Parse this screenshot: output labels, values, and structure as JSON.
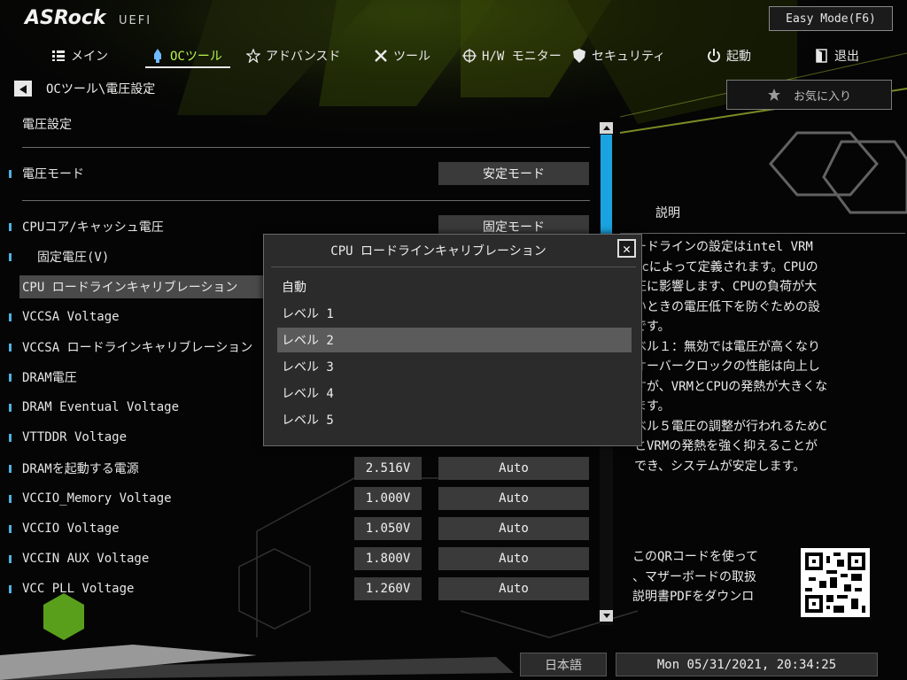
{
  "header": {
    "logo": "ASRock",
    "logo_sub": "UEFI",
    "easy_mode": "Easy Mode(F6)"
  },
  "nav": [
    {
      "label": "メイン",
      "icon": "list-icon"
    },
    {
      "label": "OCツール",
      "icon": "rocket-icon",
      "active": true
    },
    {
      "label": "アドバンスド",
      "icon": "star-icon"
    },
    {
      "label": "ツール",
      "icon": "tools-icon"
    },
    {
      "label": "H/W モニター",
      "icon": "crosshair-icon"
    },
    {
      "label": "セキュリティ",
      "icon": "shield-icon"
    },
    {
      "label": "起動",
      "icon": "power-icon"
    },
    {
      "label": "退出",
      "icon": "exit-door-icon"
    }
  ],
  "breadcrumb": "OCツール\\電圧設定",
  "favorite": "お気に入り",
  "section_title": "電圧設定",
  "rows": [
    {
      "label": "電圧モード",
      "mode": "安定モード"
    },
    {
      "label": "CPUコア/キャッシュ電圧",
      "mode": "固定モード"
    },
    {
      "label": "固定電圧(V)"
    },
    {
      "label": "CPU ロードラインキャリブレーション"
    },
    {
      "label": "VCCSA Voltage"
    },
    {
      "label": "VCCSA ロードラインキャリブレーション"
    },
    {
      "label": "DRAM電圧"
    },
    {
      "label": "DRAM Eventual Voltage"
    },
    {
      "label": "VTTDDR Voltage"
    },
    {
      "label": "DRAMを起動する電源",
      "value": "2.516V",
      "mode": "Auto"
    },
    {
      "label": "VCCIO_Memory Voltage",
      "value": "1.000V",
      "mode": "Auto"
    },
    {
      "label": "VCCIO Voltage",
      "value": "1.050V",
      "mode": "Auto"
    },
    {
      "label": "VCCIN AUX Voltage",
      "value": "1.800V",
      "mode": "Auto"
    },
    {
      "label": "VCC PLL Voltage",
      "value": "1.260V",
      "mode": "Auto"
    }
  ],
  "description": {
    "title": "説明",
    "text": "ードラインの設定はintel VRM\necによって定義されます。CPUの\n圧に影響します、CPUの負荷が大\nいときの電圧低下を防ぐための設\nです。\nベル１：無効では電圧が高くなり\nオーバークロックの性能は向上し\nすが、VRMとCPUの発熱が大きくな\nます。\nベル５電圧の調整が行われるためC\nとVRMの発熱を強く抑えることが\nでき、システムが安定します。",
    "qr_text": "このQRコードを使って\n、マザーボードの取扱\n説明書PDFをダウンロ"
  },
  "popup": {
    "title": "CPU ロードラインキャリブレーション",
    "options": [
      "自動",
      "レベル 1",
      "レベル 2",
      "レベル 3",
      "レベル 4",
      "レベル 5"
    ],
    "selected": "レベル 2"
  },
  "status": {
    "language": "日本語",
    "datetime": "Mon 05/31/2021, 20:34:25"
  },
  "colors": {
    "accent_green": "#b9f24c",
    "scroll_blue": "#1aa3e0",
    "marker_blue": "#4fb3e0"
  }
}
